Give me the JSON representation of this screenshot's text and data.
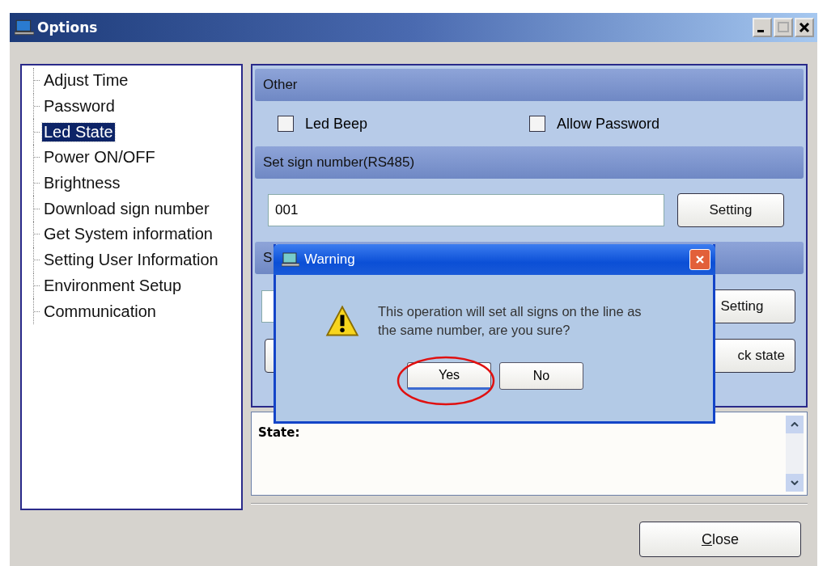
{
  "window": {
    "title": "Options"
  },
  "tree": {
    "items": [
      {
        "label": "Adjust Time",
        "selected": false
      },
      {
        "label": "Password",
        "selected": false
      },
      {
        "label": "Led State",
        "selected": true
      },
      {
        "label": "Power ON/OFF",
        "selected": false
      },
      {
        "label": "Brightness",
        "selected": false
      },
      {
        "label": "Download sign number",
        "selected": false
      },
      {
        "label": "Get System information",
        "selected": false
      },
      {
        "label": "Setting User Information",
        "selected": false
      },
      {
        "label": "Environment Setup",
        "selected": false
      },
      {
        "label": "Communication",
        "selected": false
      }
    ]
  },
  "sections": [
    {
      "kind": "checks",
      "header": "Other",
      "checkboxes": [
        {
          "label": "Led Beep",
          "checked": false
        },
        {
          "label": "Allow Password",
          "checked": false
        }
      ]
    },
    {
      "kind": "field",
      "header": "Set sign number(RS485)",
      "value": "001",
      "button": "Setting"
    },
    {
      "kind": "hidden",
      "header": "S",
      "button": "Setting",
      "button_2": "ck state"
    }
  ],
  "status": {
    "label": "State:"
  },
  "close_button": "Close",
  "dialog": {
    "title": "Warning",
    "message": "This operation will set all signs on the line as the same number, are you sure?",
    "buttons": [
      {
        "label": "Yes",
        "selected": true
      },
      {
        "label": "No",
        "selected": false
      }
    ]
  }
}
